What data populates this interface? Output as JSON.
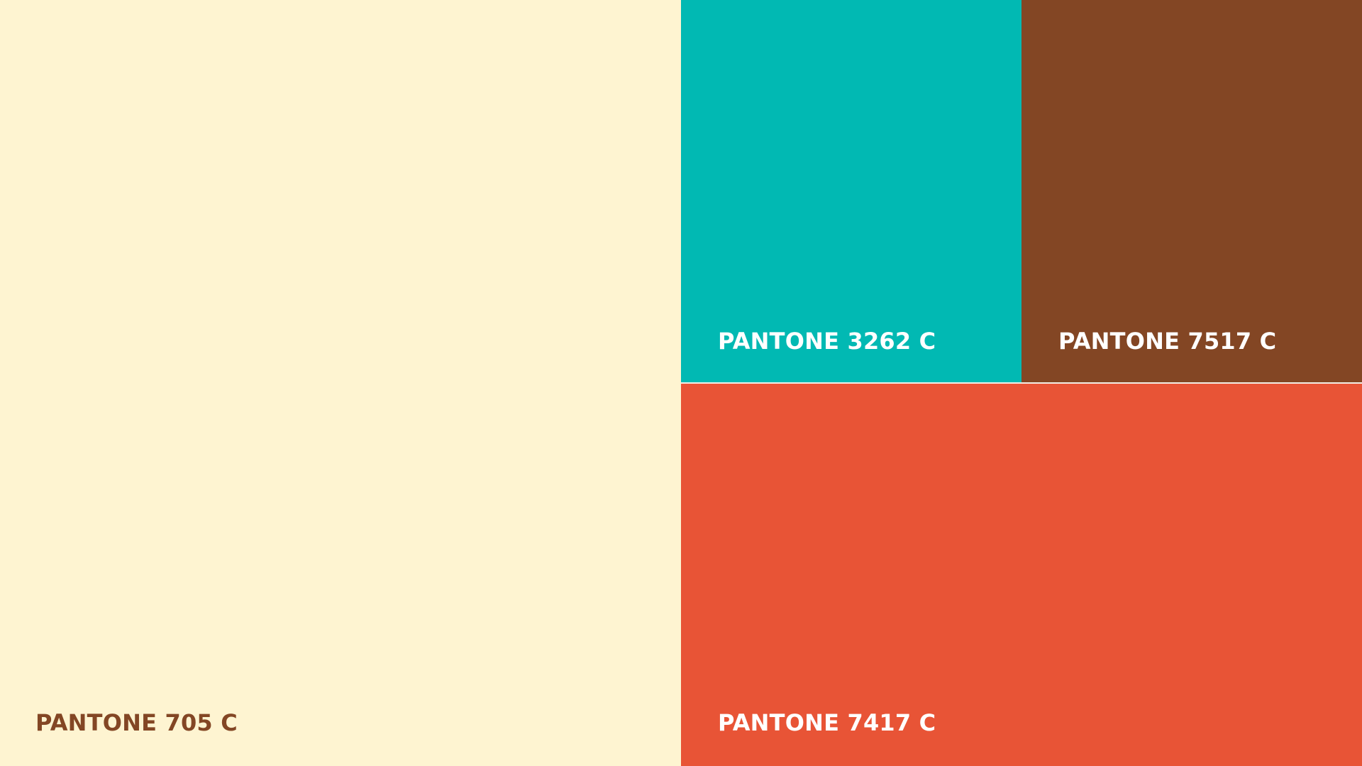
{
  "swatches": [
    {
      "name": "PANTONE 705 C",
      "color": "#FEF4D1",
      "text_color": "#834624"
    },
    {
      "name": "PANTONE 3262 C",
      "color": "#01B9B3",
      "text_color": "#FFFFFF"
    },
    {
      "name": "PANTONE 7517 C",
      "color": "#834624",
      "text_color": "#FFFFFF"
    },
    {
      "name": "PANTONE 7417 C",
      "color": "#E85436",
      "text_color": "#FFFFFF"
    }
  ]
}
